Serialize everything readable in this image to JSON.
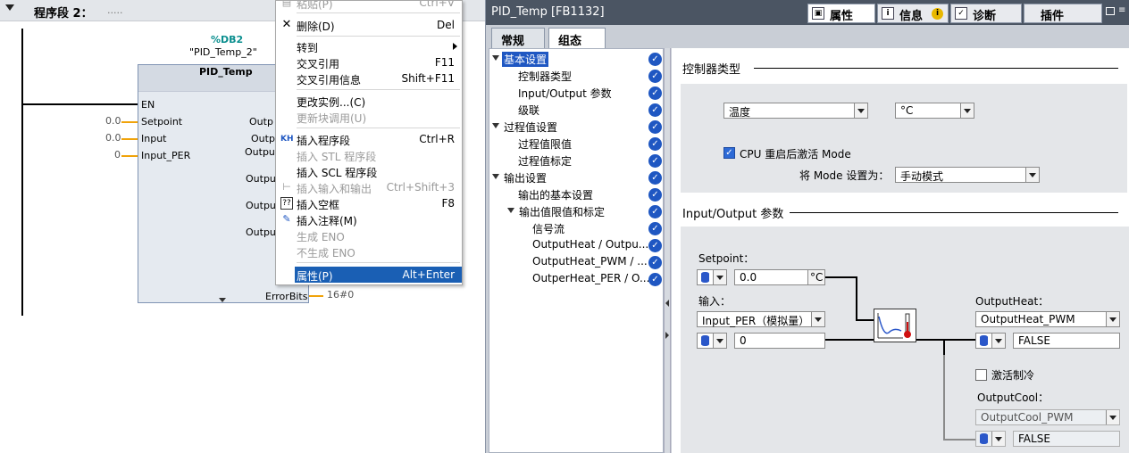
{
  "lad": {
    "network_title": "程序段 2：",
    "network_dots": ".....",
    "db_address": "%DB2",
    "db_name": "\"PID_Temp_2\"",
    "fb_name": "PID_Temp",
    "inputs": [
      {
        "name": "EN",
        "value": ""
      },
      {
        "name": "Setpoint",
        "value": "0.0"
      },
      {
        "name": "Input",
        "value": "0.0"
      },
      {
        "name": "Input_PER",
        "value": "0"
      }
    ],
    "outputs": [
      "Outp",
      "Outp",
      "Outpu",
      "Outpu",
      "Outpu",
      "Outpu"
    ],
    "errorbits_label": "ErrorBits",
    "errorbits_value": "16#0"
  },
  "context_menu": {
    "items": [
      {
        "label": "粘贴(P)",
        "shortcut": "Ctrl+V",
        "icon": "paste-icon",
        "disabled": true
      },
      {
        "label": "删除(D)",
        "shortcut": "Del",
        "icon": "delete-icon",
        "disabled": false
      },
      {
        "label": "转到",
        "shortcut": "",
        "icon": "",
        "disabled": false,
        "submenu": true
      },
      {
        "label": "交叉引用",
        "shortcut": "F11",
        "icon": "",
        "disabled": false
      },
      {
        "label": "交叉引用信息",
        "shortcut": "Shift+F11",
        "icon": "",
        "disabled": false
      },
      {
        "label": "更改实例...(C)",
        "shortcut": "",
        "icon": "",
        "disabled": false
      },
      {
        "label": "更新块调用(U)",
        "shortcut": "",
        "icon": "",
        "disabled": true
      },
      {
        "label": "插入程序段",
        "shortcut": "Ctrl+R",
        "icon": "insert-network-icon",
        "disabled": false
      },
      {
        "label": "插入 STL 程序段",
        "shortcut": "",
        "icon": "",
        "disabled": true
      },
      {
        "label": "插入 SCL 程序段",
        "shortcut": "",
        "icon": "",
        "disabled": false
      },
      {
        "label": "插入输入和输出",
        "shortcut": "Ctrl+Shift+3",
        "icon": "insert-io-icon",
        "disabled": true
      },
      {
        "label": "插入空框",
        "shortcut": "F8",
        "icon": "empty-box-icon",
        "disabled": false
      },
      {
        "label": "插入注释(M)",
        "shortcut": "",
        "icon": "comment-icon",
        "disabled": false
      },
      {
        "label": "生成 ENO",
        "shortcut": "",
        "icon": "",
        "disabled": true
      },
      {
        "label": "不生成 ENO",
        "shortcut": "",
        "icon": "",
        "disabled": true
      },
      {
        "label": "属性(P)",
        "shortcut": "Alt+Enter",
        "icon": "",
        "disabled": false,
        "selected": true
      }
    ]
  },
  "props": {
    "title": "PID_Temp [FB1132]",
    "tabs": [
      {
        "label": "属性",
        "icon": "properties-icon",
        "badge": ""
      },
      {
        "label": "信息",
        "icon": "info-icon",
        "badge": "i"
      },
      {
        "label": "诊断",
        "icon": "diagnostics-icon",
        "badge": ""
      },
      {
        "label": "插件",
        "icon": "",
        "badge": ""
      }
    ],
    "subtabs": [
      "常规",
      "组态"
    ],
    "nav": [
      {
        "label": "基本设置",
        "level": 0,
        "expanded": true,
        "selected": true
      },
      {
        "label": "控制器类型",
        "level": 1
      },
      {
        "label": "Input/Output 参数",
        "level": 1
      },
      {
        "label": "级联",
        "level": 1
      },
      {
        "label": "过程值设置",
        "level": 0,
        "expanded": true
      },
      {
        "label": "过程值限值",
        "level": 1
      },
      {
        "label": "过程值标定",
        "level": 1
      },
      {
        "label": "输出设置",
        "level": 0,
        "expanded": true
      },
      {
        "label": "输出的基本设置",
        "level": 1
      },
      {
        "label": "输出值限值和标定",
        "level": 1,
        "expanded": true
      },
      {
        "label": "信号流",
        "level": 2
      },
      {
        "label": "OutputHeat / Outpu...",
        "level": 2
      },
      {
        "label": "OutputHeat_PWM / ...",
        "level": 2
      },
      {
        "label": "OutperHeat_PER / O...",
        "level": 2
      }
    ],
    "controller_type": {
      "section_title": "控制器类型",
      "type_value": "温度",
      "unit_value": "°C",
      "cpu_restart_checked": true,
      "cpu_restart_label": "CPU 重启后激活 Mode",
      "mode_label": "将 Mode 设置为：",
      "mode_value": "手动模式"
    },
    "io": {
      "section_title": "Input/Output 参数",
      "setpoint_label": "Setpoint：",
      "setpoint_value": "0.0",
      "setpoint_unit": "°C",
      "input_label": "输入：",
      "input_select": "Input_PER（模拟量）",
      "input_value": "0",
      "outputheat_label": "OutputHeat：",
      "outputheat_select": "OutputHeat_PWM",
      "outputheat_value": "FALSE",
      "cooling_checked": false,
      "cooling_label": "激活制冷",
      "outputcool_label": "OutputCool：",
      "outputcool_select": "OutputCool_PWM",
      "outputcool_value": "FALSE"
    }
  }
}
